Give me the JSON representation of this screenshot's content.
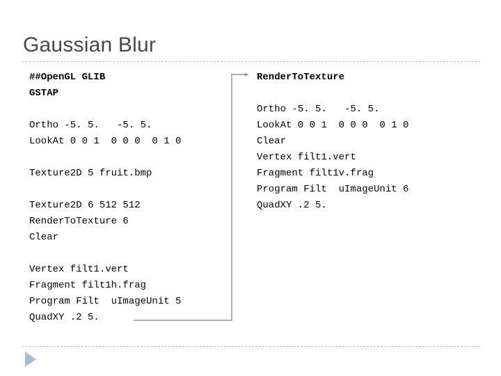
{
  "slide": {
    "title": "Gaussian Blur",
    "title_color": "#484848",
    "background_color": "#ffffff",
    "separator_color": "#b9bfc9"
  },
  "left_column": {
    "lines": [
      {
        "text": "##OpenGL GLIB",
        "bold": true
      },
      {
        "text": "GSTAP",
        "bold": true
      },
      {
        "text": "",
        "bold": false
      },
      {
        "text": "Ortho -5. 5.   -5. 5.",
        "bold": false
      },
      {
        "text": "LookAt 0 0 1  0 0 0  0 1 0",
        "bold": false
      },
      {
        "text": "",
        "bold": false
      },
      {
        "text": "Texture2D 5 fruit.bmp",
        "bold": false
      },
      {
        "text": "",
        "bold": false
      },
      {
        "text": "Texture2D 6 512 512",
        "bold": false
      },
      {
        "text": "RenderToTexture 6",
        "bold": false
      },
      {
        "text": "Clear",
        "bold": false
      },
      {
        "text": "",
        "bold": false
      },
      {
        "text": "Vertex filt1.vert",
        "bold": false
      },
      {
        "text": "Fragment filt1h.frag",
        "bold": false
      },
      {
        "text": "Program Filt  uImageUnit 5",
        "bold": false
      },
      {
        "text": "QuadXY .2 5.",
        "bold": false
      }
    ]
  },
  "right_column": {
    "lines": [
      {
        "text": "RenderToTexture",
        "bold": true
      },
      {
        "text": "",
        "bold": false
      },
      {
        "text": "Ortho -5. 5.   -5. 5.",
        "bold": false
      },
      {
        "text": "LookAt 0 0 1  0 0 0  0 1 0",
        "bold": false
      },
      {
        "text": "Clear",
        "bold": false
      },
      {
        "text": "Vertex filt1.vert",
        "bold": false
      },
      {
        "text": "Fragment filt1v.frag",
        "bold": false
      },
      {
        "text": "Program Filt  uImageUnit 6",
        "bold": false
      },
      {
        "text": "QuadXY .2 5.",
        "bold": false
      }
    ]
  },
  "connector": {
    "color": "#8894a8",
    "label": "flow-from-left-block-to-render-to-texture"
  },
  "nav": {
    "next_label": "next-slide",
    "color": "#a8bcd4"
  }
}
